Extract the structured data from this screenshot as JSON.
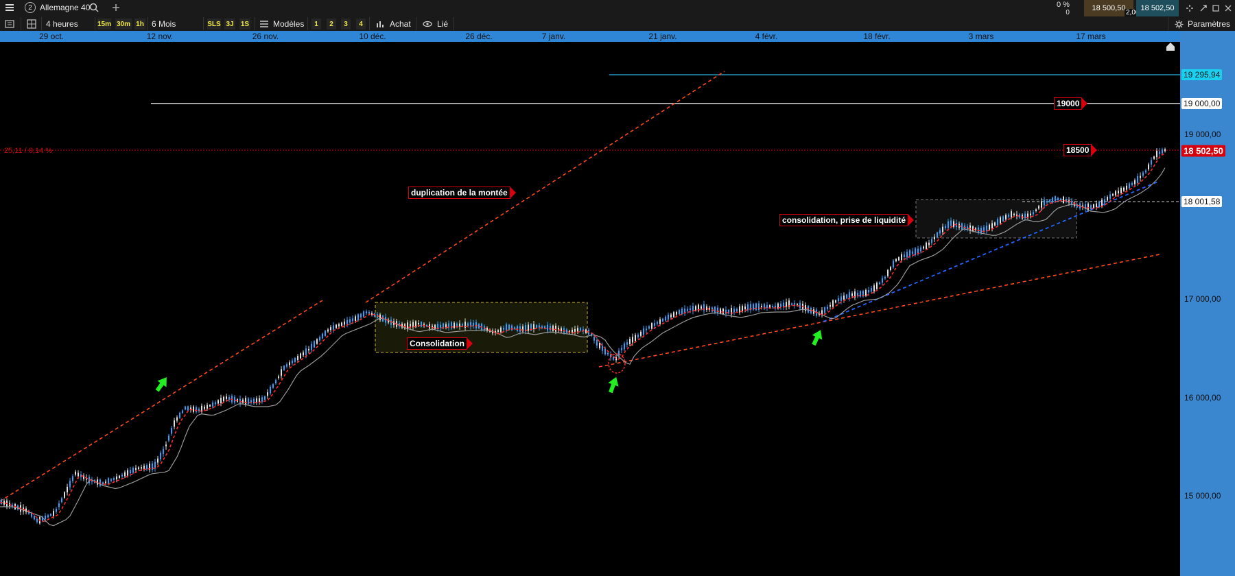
{
  "toolbar": {
    "instrument": "Allemagne 40",
    "instrument_number": "2",
    "interval": "4 heures",
    "timeframes": [
      "15m",
      "30m",
      "1h"
    ],
    "range": "6 Mois",
    "quick_ranges": [
      "SLS",
      "3J",
      "1S"
    ],
    "models_label": "Modèles",
    "layout_slots": [
      "1",
      "2",
      "3",
      "4"
    ],
    "buy_label": "Achat",
    "link_label": "Lié",
    "change_pct": "0 %",
    "change_value": "0",
    "bid": "18 500,50",
    "ask": "18 502,50",
    "spread": "2,00",
    "settings_label": "Paramètres"
  },
  "date_axis": [
    "29 oct.",
    "12 nov.",
    "26 nov.",
    "10 déc.",
    "26 déc.",
    "7 janv.",
    "21 janv.",
    "4 févr.",
    "18 févr.",
    "3 mars",
    "17 mars"
  ],
  "price_axis": [
    "19 000,00",
    "17 000,00",
    "16 000,00",
    "15 000,00"
  ],
  "levels": {
    "top": "19 295,94",
    "mid": "18 001,58",
    "current": "18 502,50",
    "r19000": "19 000,00"
  },
  "change_readout": "25,11 / 0,14 %",
  "annotations": {
    "duplication": "duplication de la montée",
    "consolidation": "Consolidation",
    "consolidation_liquidity": "consolidation, prise de liquidité",
    "level_19000": "19000",
    "level_18500": "18500"
  },
  "colors": {
    "accent_blue": "#3a87cf",
    "bull": "#2aa3ff",
    "bear": "#e0e0e0",
    "red": "#d8000c",
    "green_arrow": "#22ee22",
    "ema_red": "#ff2a2a",
    "blue_trend": "#2266ff"
  },
  "icons": [
    "menu-icon",
    "search-icon",
    "plus-icon",
    "layout-icon",
    "models-icon",
    "buy-icon",
    "link-icon",
    "settings-icon",
    "maximize-icon",
    "close-icon",
    "home-icon"
  ]
}
